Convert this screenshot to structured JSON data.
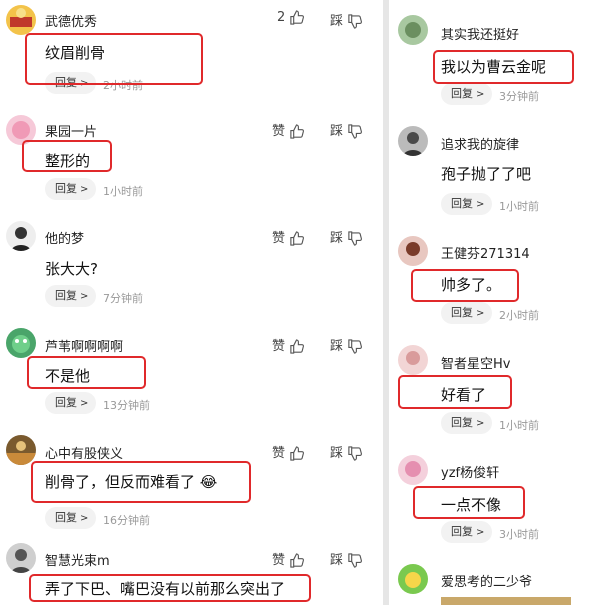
{
  "left": {
    "comments": [
      {
        "name": "武德优秀",
        "text": "纹眉削骨",
        "reply": "回复",
        "time": "2小时前",
        "like": "2",
        "dislike": "踩"
      },
      {
        "name": "果园一片",
        "text": "整形的",
        "reply": "回复",
        "time": "1小时前",
        "like": "赞",
        "dislike": "踩"
      },
      {
        "name": "他的梦",
        "text": "张大大?",
        "reply": "回复",
        "time": "7分钟前",
        "like": "赞",
        "dislike": "踩"
      },
      {
        "name": "芦苇啊啊啊啊",
        "text": "不是他",
        "reply": "回复",
        "time": "13分钟前",
        "like": "赞",
        "dislike": "踩"
      },
      {
        "name": "心中有股侠义",
        "text": "削骨了，但反而难看了",
        "emoji": "😂",
        "reply": "回复",
        "time": "16分钟前",
        "like": "赞",
        "dislike": "踩"
      },
      {
        "name": "智慧光束m",
        "text": "弄了下巴、嘴巴没有以前那么突出了",
        "like": "赞",
        "dislike": "踩"
      }
    ]
  },
  "right": {
    "comments": [
      {
        "name": "其实我还挺好",
        "text": "我以为曹云金呢",
        "reply": "回复",
        "time": "3分钟前"
      },
      {
        "name": "追求我的旋律",
        "text": "孢子抛了了吧",
        "reply": "回复",
        "time": "1小时前"
      },
      {
        "name": "王健芬271314",
        "text": "帅多了。",
        "reply": "回复",
        "time": "2小时前"
      },
      {
        "name": "智者星空Hv",
        "text": "好看了",
        "reply": "回复",
        "time": "1小时前"
      },
      {
        "name": "yzf杨俊轩",
        "text": "一点不像",
        "reply": "回复",
        "time": "3小时前"
      },
      {
        "name": "爱思考的二少爷"
      }
    ]
  },
  "colors": {
    "highlight": "#e0292b",
    "reply_bg": "#f2f2f2",
    "time": "#999999"
  }
}
